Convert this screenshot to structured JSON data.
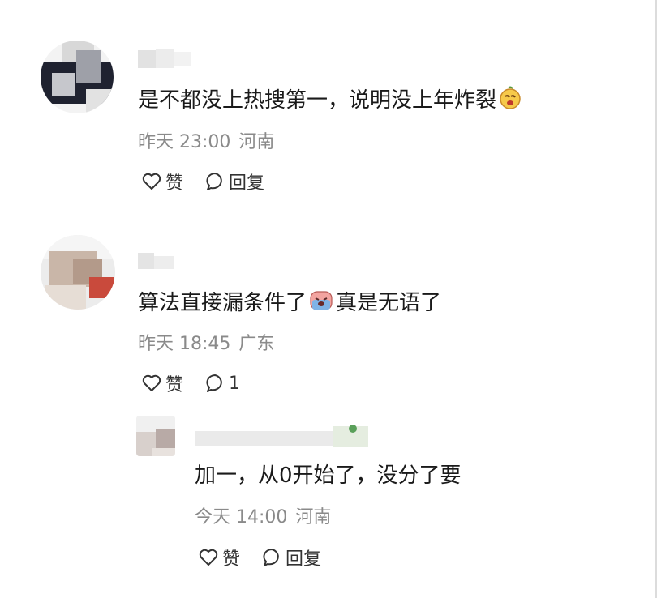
{
  "comments": [
    {
      "text_before": "是不都没上热搜第一，说明没上年炸裂",
      "emoji": "smirk-face-emoji",
      "text_after": "",
      "time": "昨天 23:00",
      "location": "河南",
      "like_label": "赞",
      "reply_label": "回复"
    },
    {
      "text_before": "算法直接漏条件了",
      "emoji": "crying-face-emoji",
      "text_after": "真是无语了",
      "time": "昨天 18:45",
      "location": "广东",
      "like_label": "赞",
      "reply_label": "1"
    }
  ],
  "reply": {
    "text": "加一，从0开始了，没分了要",
    "time": "今天 14:00",
    "location": "河南",
    "like_label": "赞",
    "reply_label": "回复"
  },
  "colors": {
    "meta_text": "#8a8a8a",
    "body_text": "#1a1a1a",
    "icon_stroke": "#333333"
  }
}
